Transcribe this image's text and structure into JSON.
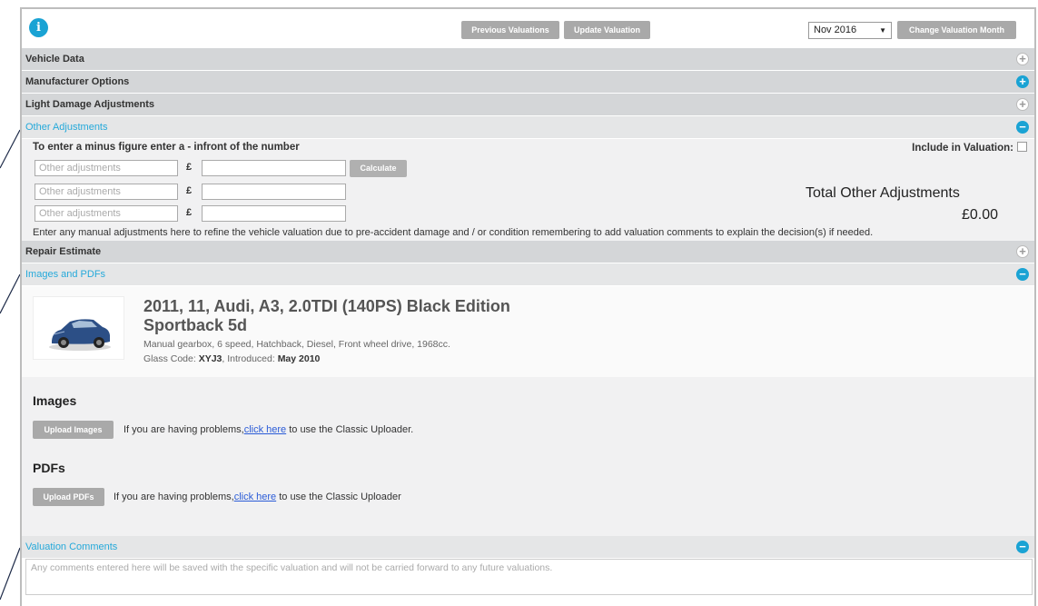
{
  "toolbar": {
    "info_icon": "i",
    "previous_valuations": "Previous Valuations",
    "update_valuation": "Update Valuation",
    "month_value": "Nov 2016",
    "change_month": "Change Valuation Month"
  },
  "sections": {
    "vehicle_data": "Vehicle Data",
    "manufacturer_options": "Manufacturer Options",
    "light_damage": "Light Damage Adjustments",
    "other_adjustments": "Other Adjustments",
    "repair_estimate": "Repair Estimate",
    "images_pdfs": "Images and PDFs",
    "valuation_comments": "Valuation Comments"
  },
  "toggle_symbols": {
    "plus": "+",
    "minus": "−"
  },
  "other_adjustments": {
    "instruction": "To enter a minus figure enter a - infront of the number",
    "include_label": "Include in Valuation:",
    "currency": "£",
    "placeholder": "Other adjustments",
    "calculate": "Calculate",
    "total_label": "Total Other Adjustments",
    "total_value": "£0.00",
    "note": "Enter any manual adjustments here to refine the vehicle valuation due to pre-accident damage and / or condition remembering to add valuation comments to explain the decision(s) if needed."
  },
  "vehicle": {
    "title_line1": "2011, 11, Audi, A3, 2.0TDI (140PS) Black Edition",
    "title_line2": "Sportback 5d",
    "spec": "Manual gearbox, 6 speed, Hatchback, Diesel, Front wheel drive, 1968cc.",
    "glass_code_label": "Glass Code:",
    "glass_code": "XYJ3",
    "introduced_label": ", Introduced:",
    "introduced": "May 2010"
  },
  "images": {
    "heading": "Images",
    "upload_button": "Upload Images",
    "help_prefix": "If you are having problems,",
    "help_link": "click here",
    "help_suffix": " to use the Classic Uploader."
  },
  "pdfs": {
    "heading": "PDFs",
    "upload_button": "Upload PDFs",
    "help_prefix": "If you are having problems,",
    "help_link": "click here",
    "help_suffix": " to use the Classic Uploader"
  },
  "comments": {
    "placeholder": "Any comments entered here will be saved with the specific valuation and will not be carried forward to any future valuations."
  },
  "colors": {
    "accent": "#1aa3d4",
    "section_bar": "#d4d6d8",
    "button": "#a9a9a9"
  }
}
